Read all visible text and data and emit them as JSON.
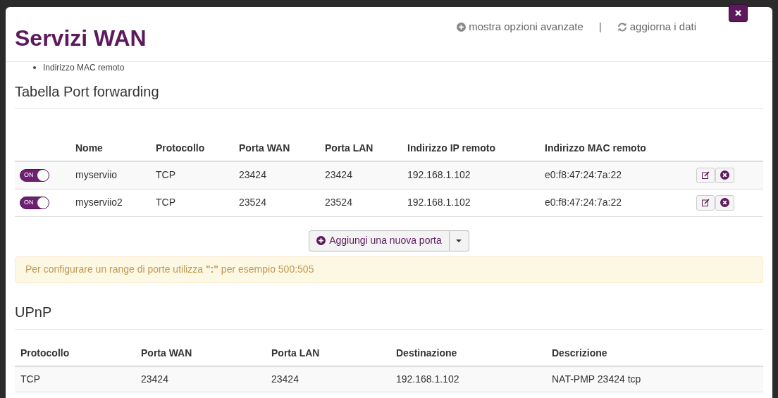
{
  "modal": {
    "title": "Servizi WAN",
    "header_links": [
      {
        "kind": "advanced",
        "label": "mostra opzioni avanzate"
      },
      {
        "kind": "refresh",
        "label": "aggiorna i dati"
      }
    ],
    "separator": "|"
  },
  "cut_item": "Indirizzo MAC remoto",
  "port_forwarding": {
    "heading": "Tabella Port forwarding",
    "columns": [
      "Nome",
      "Protocollo",
      "Porta WAN",
      "Porta LAN",
      "Indirizzo IP remoto",
      "Indirizzo MAC remoto"
    ],
    "rows": [
      {
        "on": true,
        "switch_label": "ON",
        "cells": [
          "myserviio",
          "TCP",
          "23424",
          "23424",
          "192.168.1.102",
          "e0:f8:47:24:7a:22"
        ]
      },
      {
        "on": true,
        "switch_label": "ON",
        "cells": [
          "myserviio2",
          "TCP",
          "23524",
          "23524",
          "192.168.1.102",
          "e0:f8:47:24:7a:22"
        ]
      }
    ],
    "add_button": "Aggiungi una nuova porta",
    "hint": "Per configurare un range di porte utilizza **\":\"** per esempio 500:505"
  },
  "upnp": {
    "heading": "UPnP",
    "columns": [
      "Protocollo",
      "Porta WAN",
      "Porta LAN",
      "Destinazione",
      "Descrizione"
    ],
    "rows": [
      [
        "TCP",
        "23424",
        "23424",
        "192.168.1.102",
        "NAT-PMP 23424 tcp"
      ]
    ]
  }
}
